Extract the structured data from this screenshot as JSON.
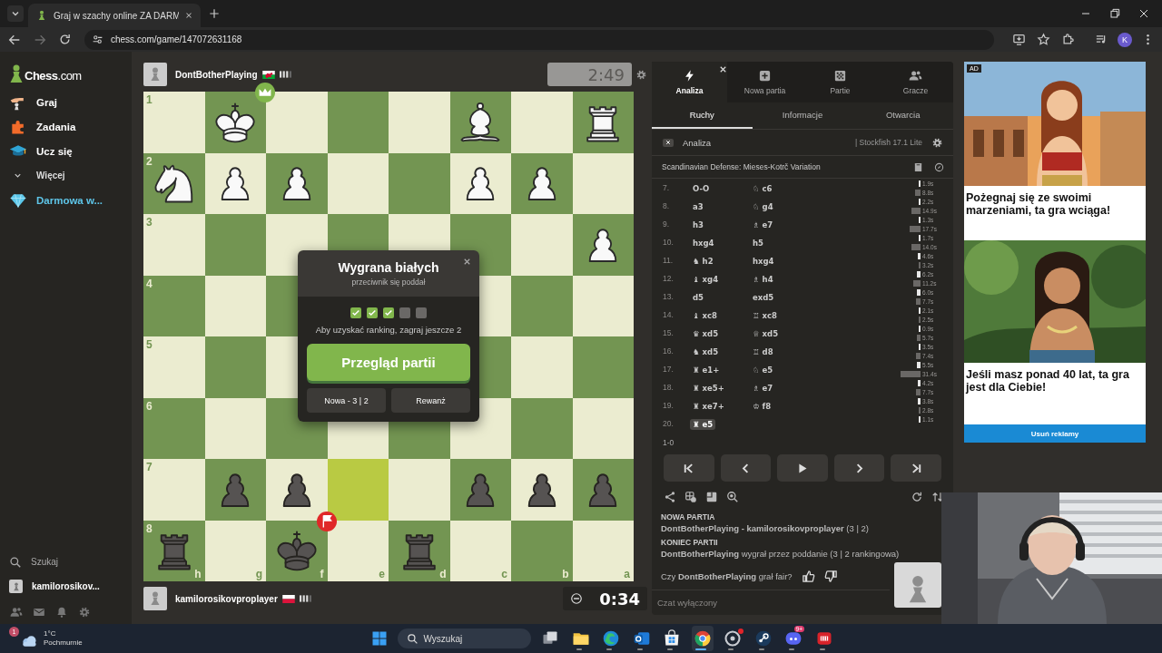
{
  "browser": {
    "tab_title": "Graj w szachy online ZA DARM",
    "url": "chess.com/game/147072631168",
    "profile_initial": "K",
    "forward_enabled": false
  },
  "sidebar": {
    "logo": "**Chess**.com",
    "items": [
      {
        "label": "Graj",
        "kind": "link"
      },
      {
        "label": "Zadania",
        "kind": "link"
      },
      {
        "label": "Ucz się",
        "kind": "link"
      },
      {
        "label": "Więcej",
        "kind": "more"
      },
      {
        "label": "Darmowa w...",
        "kind": "promo"
      }
    ],
    "search": "Szukaj",
    "user": "kamilorosikov..."
  },
  "game": {
    "top_player": {
      "name": "DontBotherPlaying",
      "clock": "2:49",
      "clock_active": false
    },
    "bottom_player": {
      "name": "kamilorosikovproplayer",
      "clock": "0:34",
      "clock_active": true
    },
    "board": {
      "files": [
        "h",
        "g",
        "f",
        "e",
        "d",
        "c",
        "b",
        "a"
      ],
      "rows": [
        {
          "rank": "1",
          "cells": [
            {
              "highlighted": false
            },
            {
              "piece": {
                "kind": "king",
                "white": true
              },
              "highlighted": false,
              "marker": {
                "kind": "winner"
              }
            },
            {
              "highlighted": false
            },
            {
              "highlighted": false
            },
            {
              "highlighted": false
            },
            {
              "piece": {
                "kind": "bishop",
                "white": true
              },
              "highlighted": false
            },
            {
              "highlighted": false
            },
            {
              "piece": {
                "kind": "rook",
                "white": true
              },
              "highlighted": false
            }
          ]
        },
        {
          "rank": "2",
          "cells": [
            {
              "piece": {
                "kind": "knight",
                "white": true
              },
              "highlighted": false
            },
            {
              "piece": {
                "kind": "pawn",
                "white": true
              },
              "highlighted": false
            },
            {
              "piece": {
                "kind": "pawn",
                "white": true
              },
              "highlighted": false
            },
            {
              "highlighted": false
            },
            {
              "highlighted": false
            },
            {
              "piece": {
                "kind": "pawn",
                "white": true
              },
              "highlighted": false
            },
            {
              "piece": {
                "kind": "pawn",
                "white": true
              },
              "highlighted": false
            },
            {
              "highlighted": false
            }
          ]
        },
        {
          "rank": "3",
          "cells": [
            {
              "highlighted": false
            },
            {
              "highlighted": false
            },
            {
              "highlighted": false
            },
            {
              "highlighted": false
            },
            {
              "highlighted": false
            },
            {
              "highlighted": false
            },
            {
              "highlighted": false
            },
            {
              "piece": {
                "kind": "pawn",
                "white": true
              },
              "highlighted": false
            }
          ]
        },
        {
          "rank": "4",
          "cells": [
            {
              "highlighted": false
            },
            {
              "highlighted": false
            },
            {
              "highlighted": false
            },
            {},
            {},
            {
              "highlighted": false
            },
            {
              "highlighted": false
            },
            {
              "highlighted": false
            }
          ]
        },
        {
          "rank": "5",
          "cells": [
            {
              "highlighted": false
            },
            {
              "highlighted": false
            },
            {
              "highlighted": false
            },
            {},
            {},
            {
              "highlighted": false
            },
            {
              "highlighted": false
            },
            {
              "highlighted": false
            }
          ]
        },
        {
          "rank": "6",
          "cells": [
            {
              "highlighted": false
            },
            {
              "highlighted": false
            },
            {
              "highlighted": false
            },
            {
              "highlighted": false
            },
            {
              "highlighted": false
            },
            {
              "highlighted": false
            },
            {
              "highlighted": false
            },
            {
              "highlighted": false
            }
          ]
        },
        {
          "rank": "7",
          "cells": [
            {
              "highlighted": false
            },
            {
              "piece": {
                "kind": "pawn",
                "white": false
              },
              "highlighted": false
            },
            {
              "piece": {
                "kind": "pawn",
                "white": false
              },
              "highlighted": false
            },
            {
              "highlighted": true
            },
            {
              "highlighted": false
            },
            {
              "piece": {
                "kind": "pawn",
                "white": false
              },
              "highlighted": false
            },
            {
              "piece": {
                "kind": "pawn",
                "white": false
              },
              "highlighted": false
            },
            {
              "piece": {
                "kind": "pawn",
                "white": false
              },
              "highlighted": false
            }
          ]
        },
        {
          "rank": "8",
          "cells": [
            {
              "piece": {
                "kind": "rook",
                "white": false
              },
              "highlighted": false
            },
            {
              "highlighted": false
            },
            {
              "piece": {
                "kind": "king",
                "white": false
              },
              "highlighted": false,
              "marker": {
                "kind": "resigned"
              }
            },
            {
              "highlighted": false
            },
            {
              "piece": {
                "kind": "rook",
                "white": false
              },
              "highlighted": false
            },
            {
              "highlighted": false
            },
            {
              "highlighted": false
            },
            {
              "highlighted": false
            }
          ]
        }
      ]
    },
    "dialog": {
      "title": "Wygrana białych",
      "subtitle": "przeciwnik się poddał",
      "progress": [
        {
          "checked": true
        },
        {
          "checked": true
        },
        {
          "checked": true
        },
        {
          "checked": false
        },
        {
          "checked": false
        }
      ],
      "note": "Aby uzyskać ranking, zagraj jeszcze 2",
      "primary": "Przegląd partii",
      "buttons": [
        "Nowa - 3 | 2",
        "Rewanż"
      ]
    }
  },
  "panel": {
    "nav": [
      {
        "label": "Analiza",
        "selected": true
      },
      {
        "label": "Nowa partia",
        "selected": false
      },
      {
        "label": "Partie",
        "selected": false
      },
      {
        "label": "Gracze",
        "selected": false
      }
    ],
    "tabs": [
      {
        "label": "Ruchy",
        "selected": true
      },
      {
        "label": "Informacje",
        "selected": false
      },
      {
        "label": "Otwarcia",
        "selected": false
      }
    ],
    "analysis": {
      "label": "Analiza",
      "on": false,
      "engine": "| Stockfish 17.1 Lite"
    },
    "opening": "Scandinavian Defense: Mieses-Kotrč Variation",
    "moves": [
      {
        "number": "7.",
        "white": {
          "san": "O-O",
          "time": "1.9s",
          "selected": false
        },
        "black": {
          "figure": "♘",
          "san": "c6",
          "time": "8.8s",
          "selected": false
        }
      },
      {
        "number": "8.",
        "white": {
          "san": "a3",
          "time": "2.2s",
          "selected": false
        },
        "black": {
          "figure": "♘",
          "san": "g4",
          "time": "14.9s",
          "selected": false
        }
      },
      {
        "number": "9.",
        "white": {
          "san": "h3",
          "time": "1.3s",
          "selected": false
        },
        "black": {
          "figure": "♗",
          "san": "e7",
          "time": "17.7s",
          "selected": false
        }
      },
      {
        "number": "10.",
        "white": {
          "san": "hxg4",
          "time": "1.7s",
          "selected": false
        },
        "black": {
          "san": "h5",
          "time": "14.0s",
          "selected": false
        }
      },
      {
        "number": "11.",
        "white": {
          "figure": "♞",
          "san": "h2",
          "time": "4.6s",
          "selected": false
        },
        "black": {
          "san": "hxg4",
          "time": "3.2s",
          "selected": false
        }
      },
      {
        "number": "12.",
        "white": {
          "figure": "♝",
          "san": "xg4",
          "time": "6.2s",
          "selected": false
        },
        "black": {
          "figure": "♗",
          "san": "h4",
          "time": "11.2s",
          "selected": false
        }
      },
      {
        "number": "13.",
        "white": {
          "san": "d5",
          "time": "6.0s",
          "selected": false
        },
        "black": {
          "san": "exd5",
          "time": "7.7s",
          "selected": false
        }
      },
      {
        "number": "14.",
        "white": {
          "figure": "♝",
          "san": "xc8",
          "time": "2.1s",
          "selected": false
        },
        "black": {
          "figure": "♖",
          "san": "xc8",
          "time": "2.5s",
          "selected": false
        }
      },
      {
        "number": "15.",
        "white": {
          "figure": "♛",
          "san": "xd5",
          "time": "0.9s",
          "selected": false
        },
        "black": {
          "figure": "♕",
          "san": "xd5",
          "time": "5.7s",
          "selected": false
        }
      },
      {
        "number": "16.",
        "white": {
          "figure": "♞",
          "san": "xd5",
          "time": "3.5s",
          "selected": false
        },
        "black": {
          "figure": "♖",
          "san": "d8",
          "time": "7.4s",
          "selected": false
        }
      },
      {
        "number": "17.",
        "white": {
          "figure": "♜",
          "san": "e1+",
          "time": "5.5s",
          "selected": false
        },
        "black": {
          "figure": "♘",
          "san": "e5",
          "time": "31.4s",
          "selected": false
        }
      },
      {
        "number": "18.",
        "white": {
          "figure": "♜",
          "san": "xe5+",
          "time": "4.2s",
          "selected": false
        },
        "black": {
          "figure": "♗",
          "san": "e7",
          "time": "7.7s",
          "selected": false
        }
      },
      {
        "number": "19.",
        "white": {
          "figure": "♜",
          "san": "xe7+",
          "time": "3.8s",
          "selected": false
        },
        "black": {
          "figure": "♔",
          "san": "f8",
          "time": "2.8s",
          "selected": false
        }
      },
      {
        "number": "20.",
        "white": {
          "figure": "♜",
          "san": "e5",
          "time": "1.1s",
          "selected": true
        }
      }
    ],
    "result": "1-0",
    "messages": [
      {
        "kind": "heading",
        "text": "NOWA PARTIA"
      },
      {
        "kind": "line",
        "text": "**DontBotherPlaying - kamilorosikovproplayer** (3 | 2)"
      },
      {
        "kind": "heading",
        "text": "KONIEC PARTII"
      },
      {
        "kind": "line",
        "text": "**DontBotherPlaying** wygrał przez poddanie (3 | 2 rankingowa)"
      }
    ],
    "fair_question": "Czy **DontBotherPlaying** grał fair?",
    "chat_placeholder": "Czat wyłączony"
  },
  "ad": {
    "label": "AD",
    "items": [
      {
        "text": "Pożegnaj się ze swoimi marzeniami, ta gra wciąga!"
      },
      {
        "text": "Jeśli masz ponad 40 lat, ta gra jest dla Ciebie!"
      }
    ],
    "remove": "Usuń reklamy"
  },
  "taskbar": {
    "weather": {
      "badge": "1",
      "temp": "1°C",
      "condition": "Pochmurnie"
    },
    "search_placeholder": "Wyszukaj",
    "apps": [
      {
        "running": false,
        "active": false,
        "alert": false
      },
      {
        "running": true,
        "active": false,
        "alert": false
      },
      {
        "running": true,
        "active": false,
        "alert": false
      },
      {
        "running": true,
        "active": false,
        "alert": false
      },
      {
        "running": true,
        "active": false,
        "alert": false
      },
      {
        "running": true,
        "active": true,
        "alert": false
      },
      {
        "running": true,
        "active": false,
        "alert": true
      },
      {
        "running": true,
        "active": false,
        "alert": false
      },
      {
        "running": true,
        "active": false,
        "alert": false,
        "badge": "9+"
      },
      {
        "running": true,
        "active": false,
        "alert": false
      }
    ]
  }
}
